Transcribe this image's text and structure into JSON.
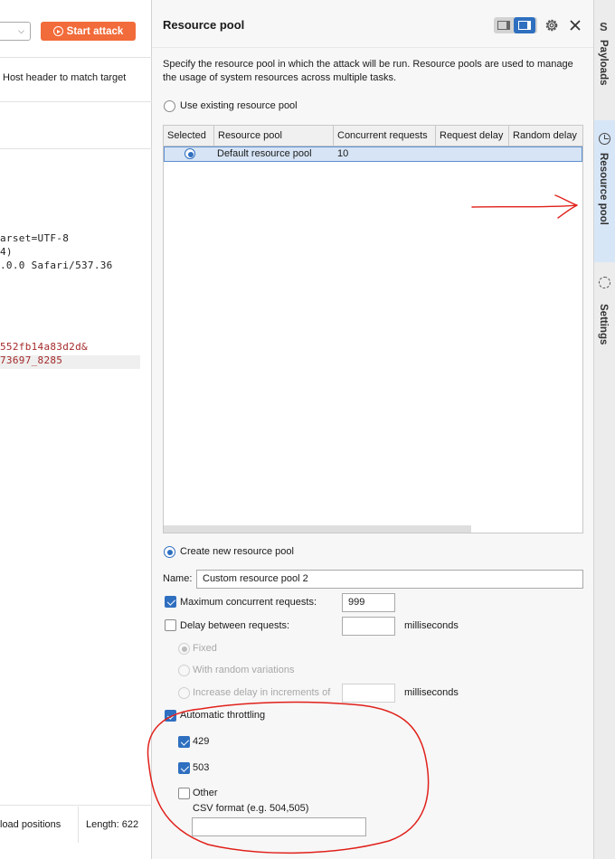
{
  "left": {
    "start_attack": "Start attack",
    "host_header_text": "Host header to match target",
    "code_lines": [
      "arset=UTF-8",
      "4)",
      ".0.0 Safari/537.36"
    ],
    "code_lines_red": [
      "552fb14a83d2d&",
      "73697_8285"
    ],
    "payload_positions": "load positions",
    "length": "Length: 622"
  },
  "panel": {
    "title": "Resource pool",
    "description": "Specify the resource pool in which the attack will be run. Resource pools are used to manage the usage of system resources across multiple tasks.",
    "use_existing_label": "Use existing resource pool",
    "use_existing_selected": false,
    "table": {
      "columns": [
        "Selected",
        "Resource pool",
        "Concurrent requests",
        "Request delay",
        "Random delay"
      ],
      "rows": [
        {
          "selected": true,
          "pool": "Default resource pool",
          "concurrent": "10",
          "request_delay": "",
          "random_delay": ""
        }
      ]
    },
    "create_new_label": "Create new resource pool",
    "create_new_selected": true,
    "name_label": "Name:",
    "name_value": "Custom resource pool 2",
    "max_concurrent_label": "Maximum concurrent requests:",
    "max_concurrent_checked": true,
    "max_concurrent_value": "999",
    "delay_label": "Delay between requests:",
    "delay_checked": false,
    "delay_value": "",
    "milliseconds": "milliseconds",
    "fixed_label": "Fixed",
    "random_variations_label": "With random variations",
    "increase_delay_label": "Increase delay in increments of",
    "increase_delay_value": "",
    "auto_throttling_label": "Automatic throttling",
    "auto_throttling_checked": true,
    "code_429": "429",
    "code_429_checked": true,
    "code_503": "503",
    "code_503_checked": true,
    "other_label": "Other",
    "other_checked": false,
    "csv_label": "CSV format (e.g. 504,505)",
    "csv_value": ""
  },
  "side_tabs": [
    {
      "label": "Payloads",
      "icon": "dollar-icon",
      "active": false
    },
    {
      "label": "Resource pool",
      "icon": "gauge-icon",
      "active": true
    },
    {
      "label": "Settings",
      "icon": "gear-icon",
      "active": false
    }
  ],
  "colors": {
    "accent": "#2f6fc0",
    "start_button": "#f26b3a",
    "annotation": "#e0201a",
    "active_tab": "#d7e6f7"
  }
}
